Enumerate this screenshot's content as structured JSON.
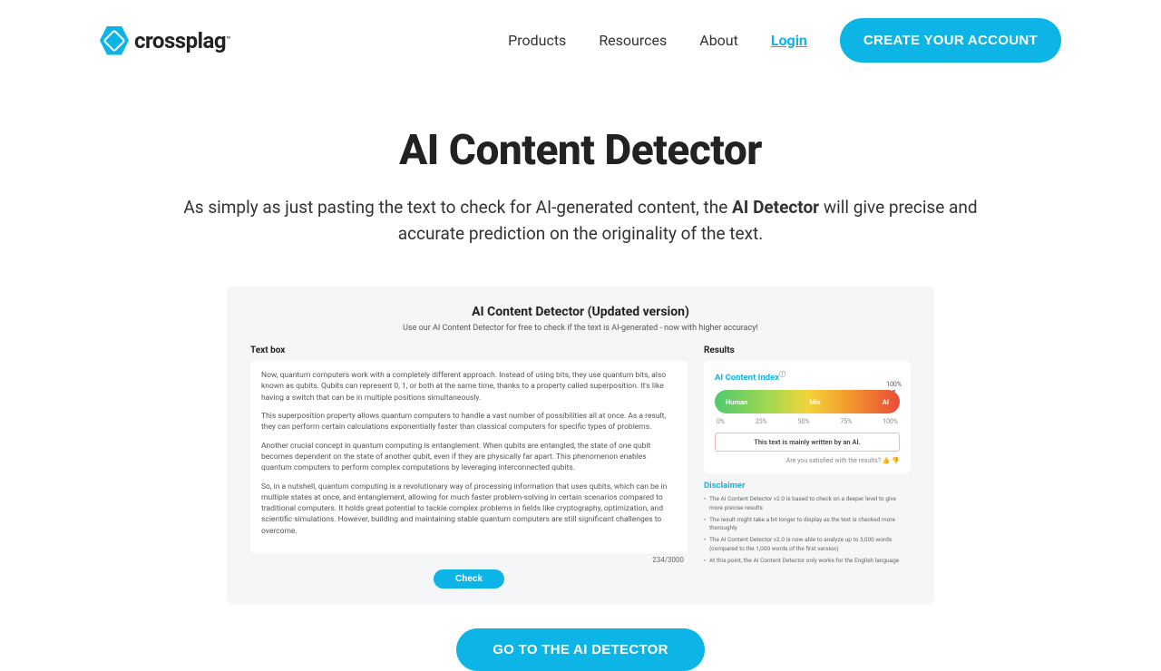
{
  "brand": {
    "name": "crossplag",
    "tm": "™"
  },
  "nav": {
    "products": "Products",
    "resources": "Resources",
    "about": "About",
    "login": "Login",
    "cta": "CREATE YOUR ACCOUNT"
  },
  "hero": {
    "title": "AI Content Detector",
    "sub_pre": "As simply as just pasting the text to check for AI-generated content, the ",
    "sub_bold": "AI Detector",
    "sub_post": " will give precise and accurate prediction on the originality of the text."
  },
  "shot": {
    "title": "AI Content Detector (Updated version)",
    "sub": "Use our AI Content Detector for free to check if the text is AI-generated - now with higher accuracy!",
    "textbox_label": "Text box",
    "p1": "Now, quantum computers work with a completely different approach. Instead of using bits, they use quantum bits, also known as qubits. Qubits can represent 0, 1, or both at the same time, thanks to a property called superposition. It's like having a switch that can be in multiple positions simultaneously.",
    "p2": "This superposition property allows quantum computers to handle a vast number of possibilities all at once. As a result, they can perform certain calculations exponentially faster than classical computers for specific types of problems.",
    "p3": "Another crucial concept in quantum computing is entanglement. When qubits are entangled, the state of one qubit becomes dependent on the state of another qubit, even if they are physically far apart. This phenomenon enables quantum computers to perform complex computations by leveraging interconnected qubits.",
    "p4": "So, in a nutshell, quantum computing is a revolutionary way of processing information that uses qubits, which can be in multiple states at once, and entanglement, allowing for much faster problem-solving in certain scenarios compared to traditional computers. It holds great potential to tackle complex problems in fields like cryptography, optimization, and scientific simulations. However, building and maintaining stable quantum computers are still significant challenges to overcome.",
    "counter": "234/3000",
    "check": "Check",
    "results_label": "Results",
    "index_label": "AI Content Index",
    "gauge": {
      "human": "Human",
      "mix": "Mix",
      "ai": "AI",
      "marker": "100%"
    },
    "scale": {
      "s0": "0%",
      "s25": "25%",
      "s50": "50%",
      "s75": "75%",
      "s100": "100%"
    },
    "verdict": "This text is mainly written by an AI.",
    "feedback": "Are you satisfied with the results? 👍 👎",
    "disclaimer_label": "Disclaimer",
    "d1": "The AI Content Detector v2.0 is based to check on a deeper level to give more precise results",
    "d2": "The result might take a bit longer to display as the text is checked more thoroughly",
    "d3": "The AI Content Detector v2.0 is now able to analyze up to 3,000 words (compared to the 1,000 words of the first version)",
    "d4": "At this point, the AI Content Detector only works for the English language"
  },
  "bottom_cta": "GO TO THE AI DETECTOR"
}
